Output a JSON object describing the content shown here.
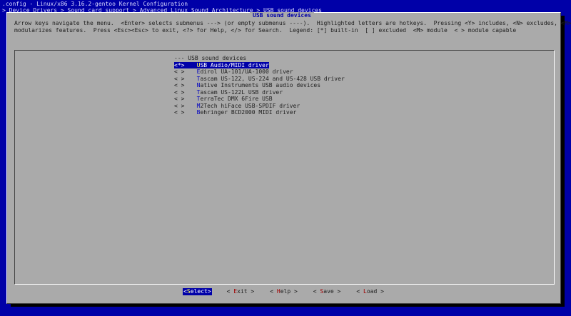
{
  "header": {
    "title": ".config - Linux/x86 3.16.2-gentoo Kernel Configuration",
    "breadcrumb": "> Device Drivers > Sound card support > Advanced Linux Sound Architecture > USB sound devices"
  },
  "dialog": {
    "title": "USB sound devices",
    "help_lines": [
      "Arrow keys navigate the menu.  <Enter> selects submenus ---> (or empty submenus ----).  Highlighted letters are hotkeys.  Pressing <Y> includes, <N> excludes, <M>",
      "modularizes features.  Press <Esc><Esc> to exit, <?> for Help, </> for Search.  Legend: [*] built-in  [ ] excluded  <M> module  < > module capable"
    ]
  },
  "menu": {
    "header": "--- USB sound devices",
    "items": [
      {
        "box": "<*>",
        "hot": "U",
        "rest": "SB Audio/MIDI driver",
        "selected": true
      },
      {
        "box": "< >",
        "hot": "E",
        "rest": "dirol UA-101/UA-1000 driver"
      },
      {
        "box": "< >",
        "hot": "T",
        "rest": "ascam US-122, US-224 and US-428 USB driver"
      },
      {
        "box": "< >",
        "hot": "N",
        "rest": "ative Instruments USB audio devices"
      },
      {
        "box": "< >",
        "hot": "T",
        "rest": "ascam US-122L USB driver"
      },
      {
        "box": "< >",
        "hot": "T",
        "rest": "erraTec DMX 6Fire USB"
      },
      {
        "box": "< >",
        "hot": "M",
        "rest": "2Tech hiFace USB-SPDIF driver"
      },
      {
        "box": "< >",
        "hot": "B",
        "rest": "ehringer BCD2000 MIDI driver"
      }
    ]
  },
  "buttons": [
    {
      "pre": "<",
      "hk": "S",
      "post": "elect>",
      "active": true
    },
    {
      "pre": "< ",
      "hk": "E",
      "post": "xit >"
    },
    {
      "pre": "< ",
      "hk": "H",
      "post": "elp >"
    },
    {
      "pre": "< ",
      "hk": "S",
      "post": "ave >"
    },
    {
      "pre": "< ",
      "hk": "L",
      "post": "oad >"
    }
  ]
}
